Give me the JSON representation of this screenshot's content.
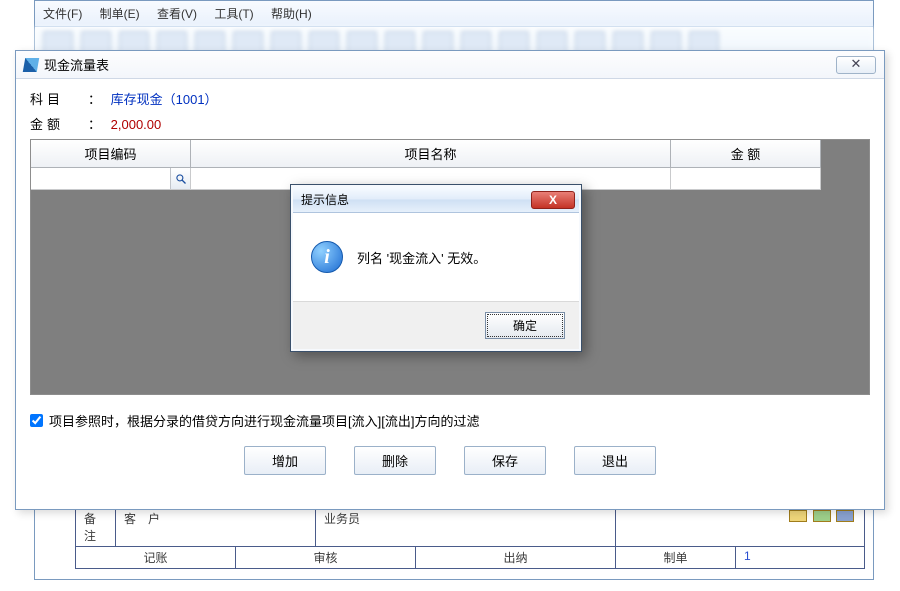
{
  "main": {
    "menus": [
      "文件(F)",
      "制单(E)",
      "查看(V)",
      "工具(T)",
      "帮助(H)"
    ]
  },
  "cf": {
    "title": "现金流量表",
    "subject_label": "科目",
    "subject_value": "库存现金（1001）",
    "amount_label": "金额",
    "amount_value": "2,000.00",
    "headers": {
      "code": "项目编码",
      "name": "项目名称",
      "money": "金 额"
    },
    "row0": {
      "code": "",
      "name": "",
      "money": ""
    },
    "checkbox_label": "项目参照时，根据分录的借贷方向进行现金流量项目[流入][流出]方向的过滤",
    "buttons": {
      "add": "增加",
      "del": "删除",
      "save": "保存",
      "exit": "退出"
    }
  },
  "dialog": {
    "title": "提示信息",
    "message": "列名 '现金流入' 无效。",
    "ok": "确定"
  },
  "bottom": {
    "lbl_remark": "备注",
    "lbl_customer": "客　户",
    "lbl_operator": "业务员",
    "lbl_book": "记账",
    "lbl_audit": "审核",
    "lbl_cashier": "出纳",
    "lbl_maker": "制单",
    "maker_value": "1"
  }
}
